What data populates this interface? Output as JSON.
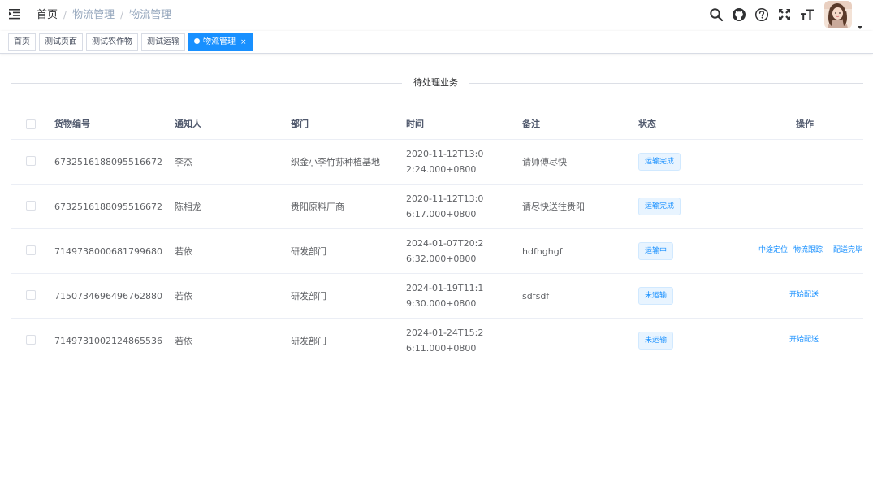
{
  "navbar": {
    "hamburger_icon": "hamburger-icon",
    "breadcrumb": [
      "首页",
      "物流管理",
      "物流管理"
    ],
    "breadcrumb_separator": "/",
    "right_icons": [
      "search-icon",
      "github-icon",
      "question-icon",
      "fullscreen-icon",
      "font-size-icon"
    ],
    "avatar_caret_icon": "caret-down-icon"
  },
  "tags": [
    {
      "label": "首页",
      "active": false
    },
    {
      "label": "测试页面",
      "active": false
    },
    {
      "label": "测试农作物",
      "active": false
    },
    {
      "label": "测试运输",
      "active": false
    },
    {
      "label": "物流管理",
      "active": true,
      "close": "×"
    }
  ],
  "section": {
    "title": "待处理业务"
  },
  "table": {
    "headers": [
      "货物编号",
      "通知人",
      "部门",
      "时间",
      "备注",
      "状态",
      "操作"
    ],
    "rows": [
      {
        "id": "6732516188095516672",
        "notifier": "李杰",
        "dept": "织金小李竹荪种植基地",
        "time": "2020-11-12T13:02:24.000+0800",
        "note": "请师傅尽快",
        "status": "运输完成",
        "actions": []
      },
      {
        "id": "6732516188095516672",
        "notifier": "陈相龙",
        "dept": "贵阳原料厂商",
        "time": "2020-11-12T13:06:17.000+0800",
        "note": "请尽快送往贵阳",
        "status": "运输完成",
        "actions": []
      },
      {
        "id": "7149738000681799680",
        "notifier": "若依",
        "dept": "研发部门",
        "time": "2024-01-07T20:26:32.000+0800",
        "note": "hdfhghgf",
        "status": "运输中",
        "actions": [
          "中途定位",
          "物流跟踪",
          "配送完毕"
        ]
      },
      {
        "id": "7150734696496762880",
        "notifier": "若依",
        "dept": "研发部门",
        "time": "2024-01-19T11:19:30.000+0800",
        "note": "sdfsdf",
        "status": "未运输",
        "actions": [
          "开始配送"
        ]
      },
      {
        "id": "7149731002124865536",
        "notifier": "若依",
        "dept": "研发部门",
        "time": "2024-01-24T15:26:11.000+0800",
        "note": "",
        "status": "未运输",
        "actions": [
          "开始配送"
        ]
      }
    ]
  },
  "colors": {
    "accent": "#1890ff",
    "badge_bg": "#e8f4ff",
    "header_text": "#515a6e",
    "body_text": "#606266",
    "border": "#ebeef5"
  }
}
